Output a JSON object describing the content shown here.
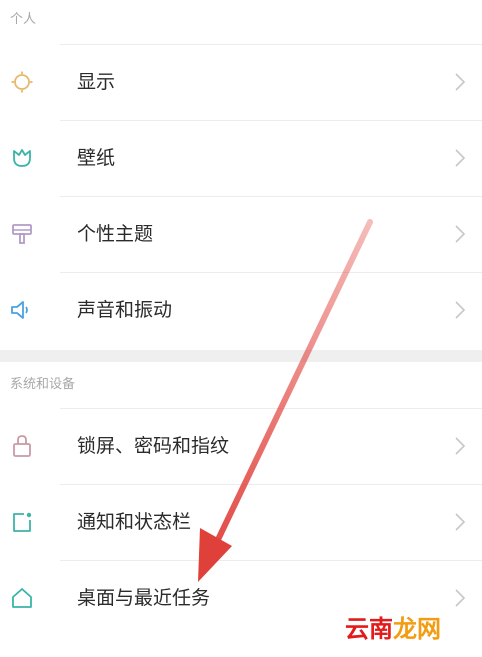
{
  "sections": {
    "personal": "个人",
    "system": "系统和设备"
  },
  "items": [
    {
      "label": "显示",
      "icon": "sun-icon"
    },
    {
      "label": "壁纸",
      "icon": "tulip-icon"
    },
    {
      "label": "个性主题",
      "icon": "paint-brush-icon"
    },
    {
      "label": "声音和振动",
      "icon": "speaker-icon"
    },
    {
      "label": "锁屏、密码和指纹",
      "icon": "lock-icon"
    },
    {
      "label": "通知和状态栏",
      "icon": "notification-icon"
    },
    {
      "label": "桌面与最近任务",
      "icon": "home-icon"
    }
  ],
  "watermark": {
    "part1": "云南",
    "part2": "龙网"
  },
  "colors": {
    "display_icon": "#e8b86b",
    "wallpaper_icon": "#3bb4a7",
    "theme_icon": "#b39bc9",
    "sound_icon": "#4aa3df",
    "lock_icon": "#c89aa6",
    "notification_icon": "#3bb4a7",
    "home_icon": "#3bb4a7",
    "arrow": "#e0403a"
  }
}
